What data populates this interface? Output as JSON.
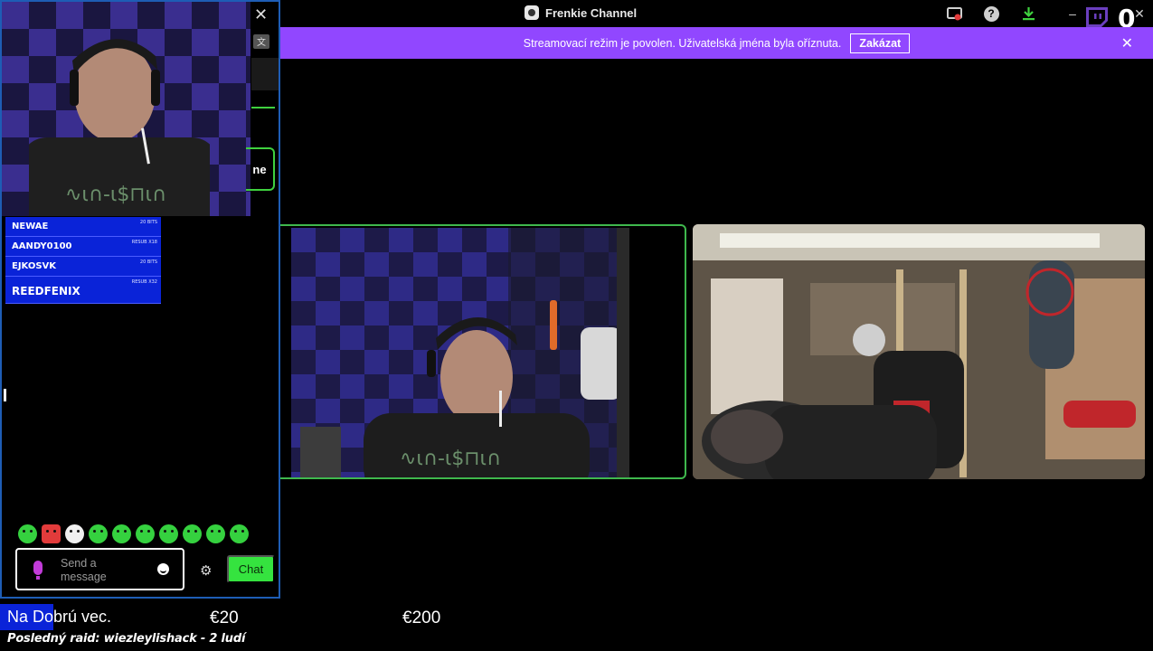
{
  "window": {
    "title": "Frenkie Channel",
    "notification_count": "0"
  },
  "banner": {
    "message": "Streamovací režim je povolen. Uživatelská jména byla oříznuta.",
    "disable_label": "Zakázat"
  },
  "chat_panel": {
    "partial_button_label": "ne",
    "alerts": [
      {
        "name": "NEWAE",
        "tag": "20 BITS"
      },
      {
        "name": "AANDY0100",
        "tag": "RESUB X18"
      },
      {
        "name": "EJKOSVK",
        "tag": "20 BITS"
      },
      {
        "name": "REEDFENIX",
        "tag": "RESUB X32"
      }
    ],
    "emotes": [
      "frog-emote",
      "red-emote",
      "white-emote",
      "frog-emote",
      "frog-emote",
      "frog-emote",
      "frog-emote",
      "frog-emote",
      "frog-emote",
      "frog-emote"
    ],
    "input_placeholder": "Send a message",
    "chat_button_label": "Chat"
  },
  "bottom_bar": {
    "donation_label_prefix": "Na Do",
    "donation_label_rest": "brú vec.",
    "amount_current": "€20",
    "amount_goal": "€200",
    "last_raid": "Posledný raid: wiezleylishack - 2 ludí"
  },
  "colors": {
    "twitch_purple": "#9147ff",
    "alert_blue": "#0a23d8",
    "chat_green": "#35e33f",
    "panel_border": "#1e5db5"
  }
}
